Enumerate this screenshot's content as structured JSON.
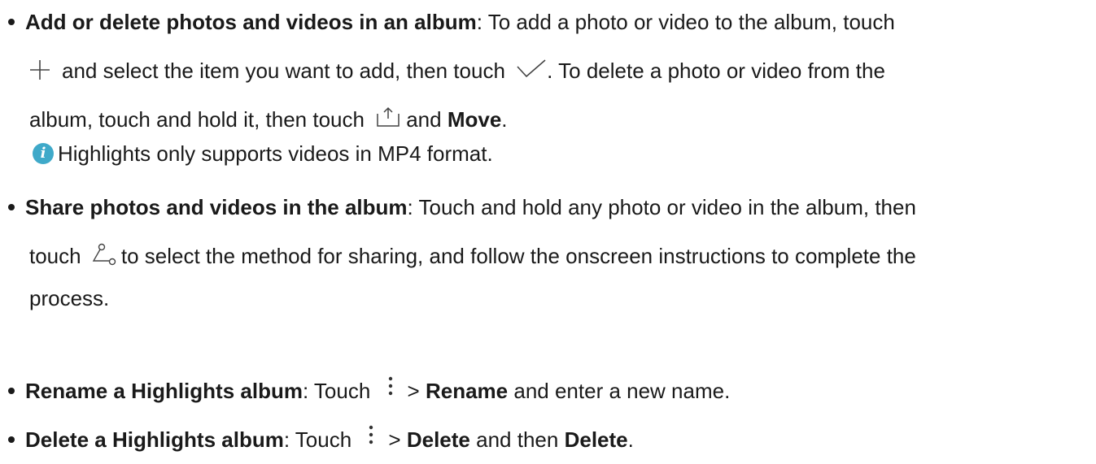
{
  "items": [
    {
      "title": "Add or delete photos and videos in an album",
      "text1": ": To add a photo or video to the album, touch",
      "text2": "and select the item you want to add, then touch",
      "text3": ". To delete a photo or video from the",
      "text4": "album, touch and hold it, then touch",
      "text5": "and",
      "bold_move": "Move",
      "text6": ".",
      "note": "Highlights only supports videos in MP4 format."
    },
    {
      "title": "Share photos and videos in the album",
      "text1": ": Touch and hold any photo or video in the album, then",
      "text2": "touch",
      "text3": "to select the method for sharing, and follow the onscreen instructions to complete the",
      "text4": "process."
    },
    {
      "title": "Rename a Highlights album",
      "text1": ": Touch",
      "text2": ">",
      "bold_action": "Rename",
      "text3": "and enter a new name."
    },
    {
      "title": "Delete a Highlights album",
      "text1": ": Touch",
      "text2": ">",
      "bold_action": "Delete",
      "text3": "and then",
      "bold_action2": "Delete",
      "text4": "."
    }
  ],
  "icons": {
    "add": "plus-icon",
    "confirm": "checkmark-icon",
    "share": "share-icon",
    "share_alt": "share-nodes-icon",
    "more": "more-vertical-icon",
    "note": "info-icon"
  },
  "colors": {
    "text": "#1a1a1a",
    "note_icon": "#3fa9c9"
  }
}
